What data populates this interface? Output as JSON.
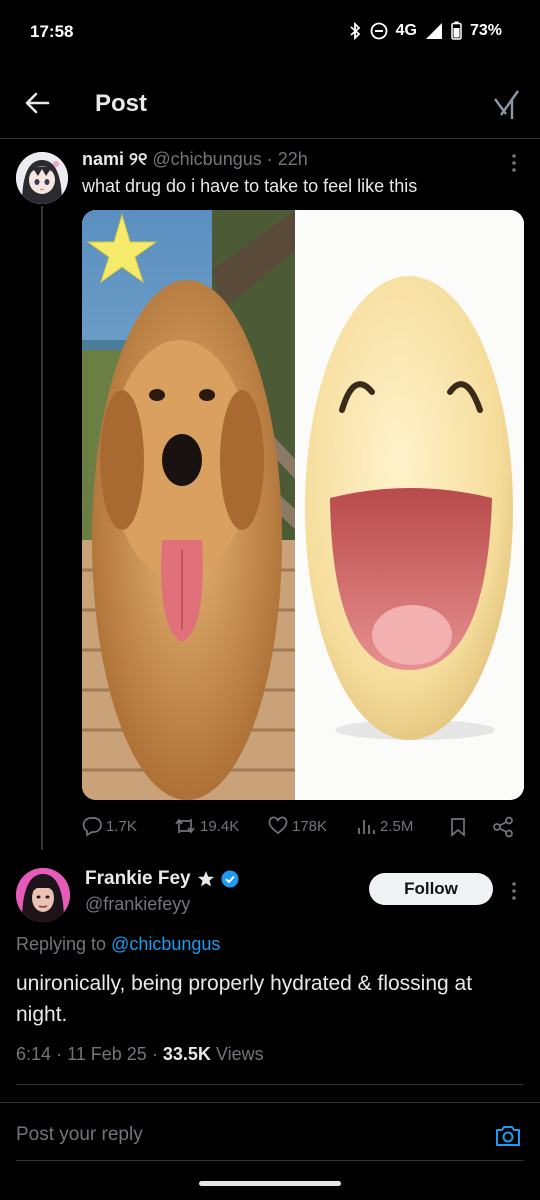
{
  "colors": {
    "background": "#000000",
    "text": "#e7e9ea",
    "muted": "#71767b",
    "accent": "#1d9bf0",
    "divider": "#2f3336"
  },
  "status_bar": {
    "time": "17:58",
    "network": "4G",
    "battery": "73%",
    "icons": [
      "bluetooth-icon",
      "do-not-disturb-icon",
      "signal-icon",
      "battery-icon"
    ]
  },
  "header": {
    "title": "Post",
    "back_icon": "arrow-left-icon",
    "grok_icon": "grok-icon"
  },
  "parent_post": {
    "display_name": "nami",
    "name_suffix": "୨୧",
    "handle": "@chicbungus",
    "separator": "·",
    "time": "22h",
    "text": "what drug do i have to take to feel like this",
    "media_description_icons": [
      "star-sticker",
      "golden-retriever-photo",
      "laughing-emoticon"
    ],
    "stats": {
      "replies": "1.7K",
      "reposts": "19.4K",
      "likes": "178K",
      "views": "2.5M"
    }
  },
  "reply_post": {
    "display_name": "Frankie Fey",
    "handle": "@frankiefeyy",
    "follow_label": "Follow",
    "replying_prefix": "Replying to",
    "replying_handle": "@chicbungus",
    "text": "unironically, being properly hydrated & flossing at night.",
    "time": "6:14",
    "separator": "·",
    "date": "11 Feb 25",
    "views_count": "33.5K",
    "views_label": "Views"
  },
  "composer": {
    "placeholder": "Post your reply",
    "camera_icon": "camera-icon"
  }
}
